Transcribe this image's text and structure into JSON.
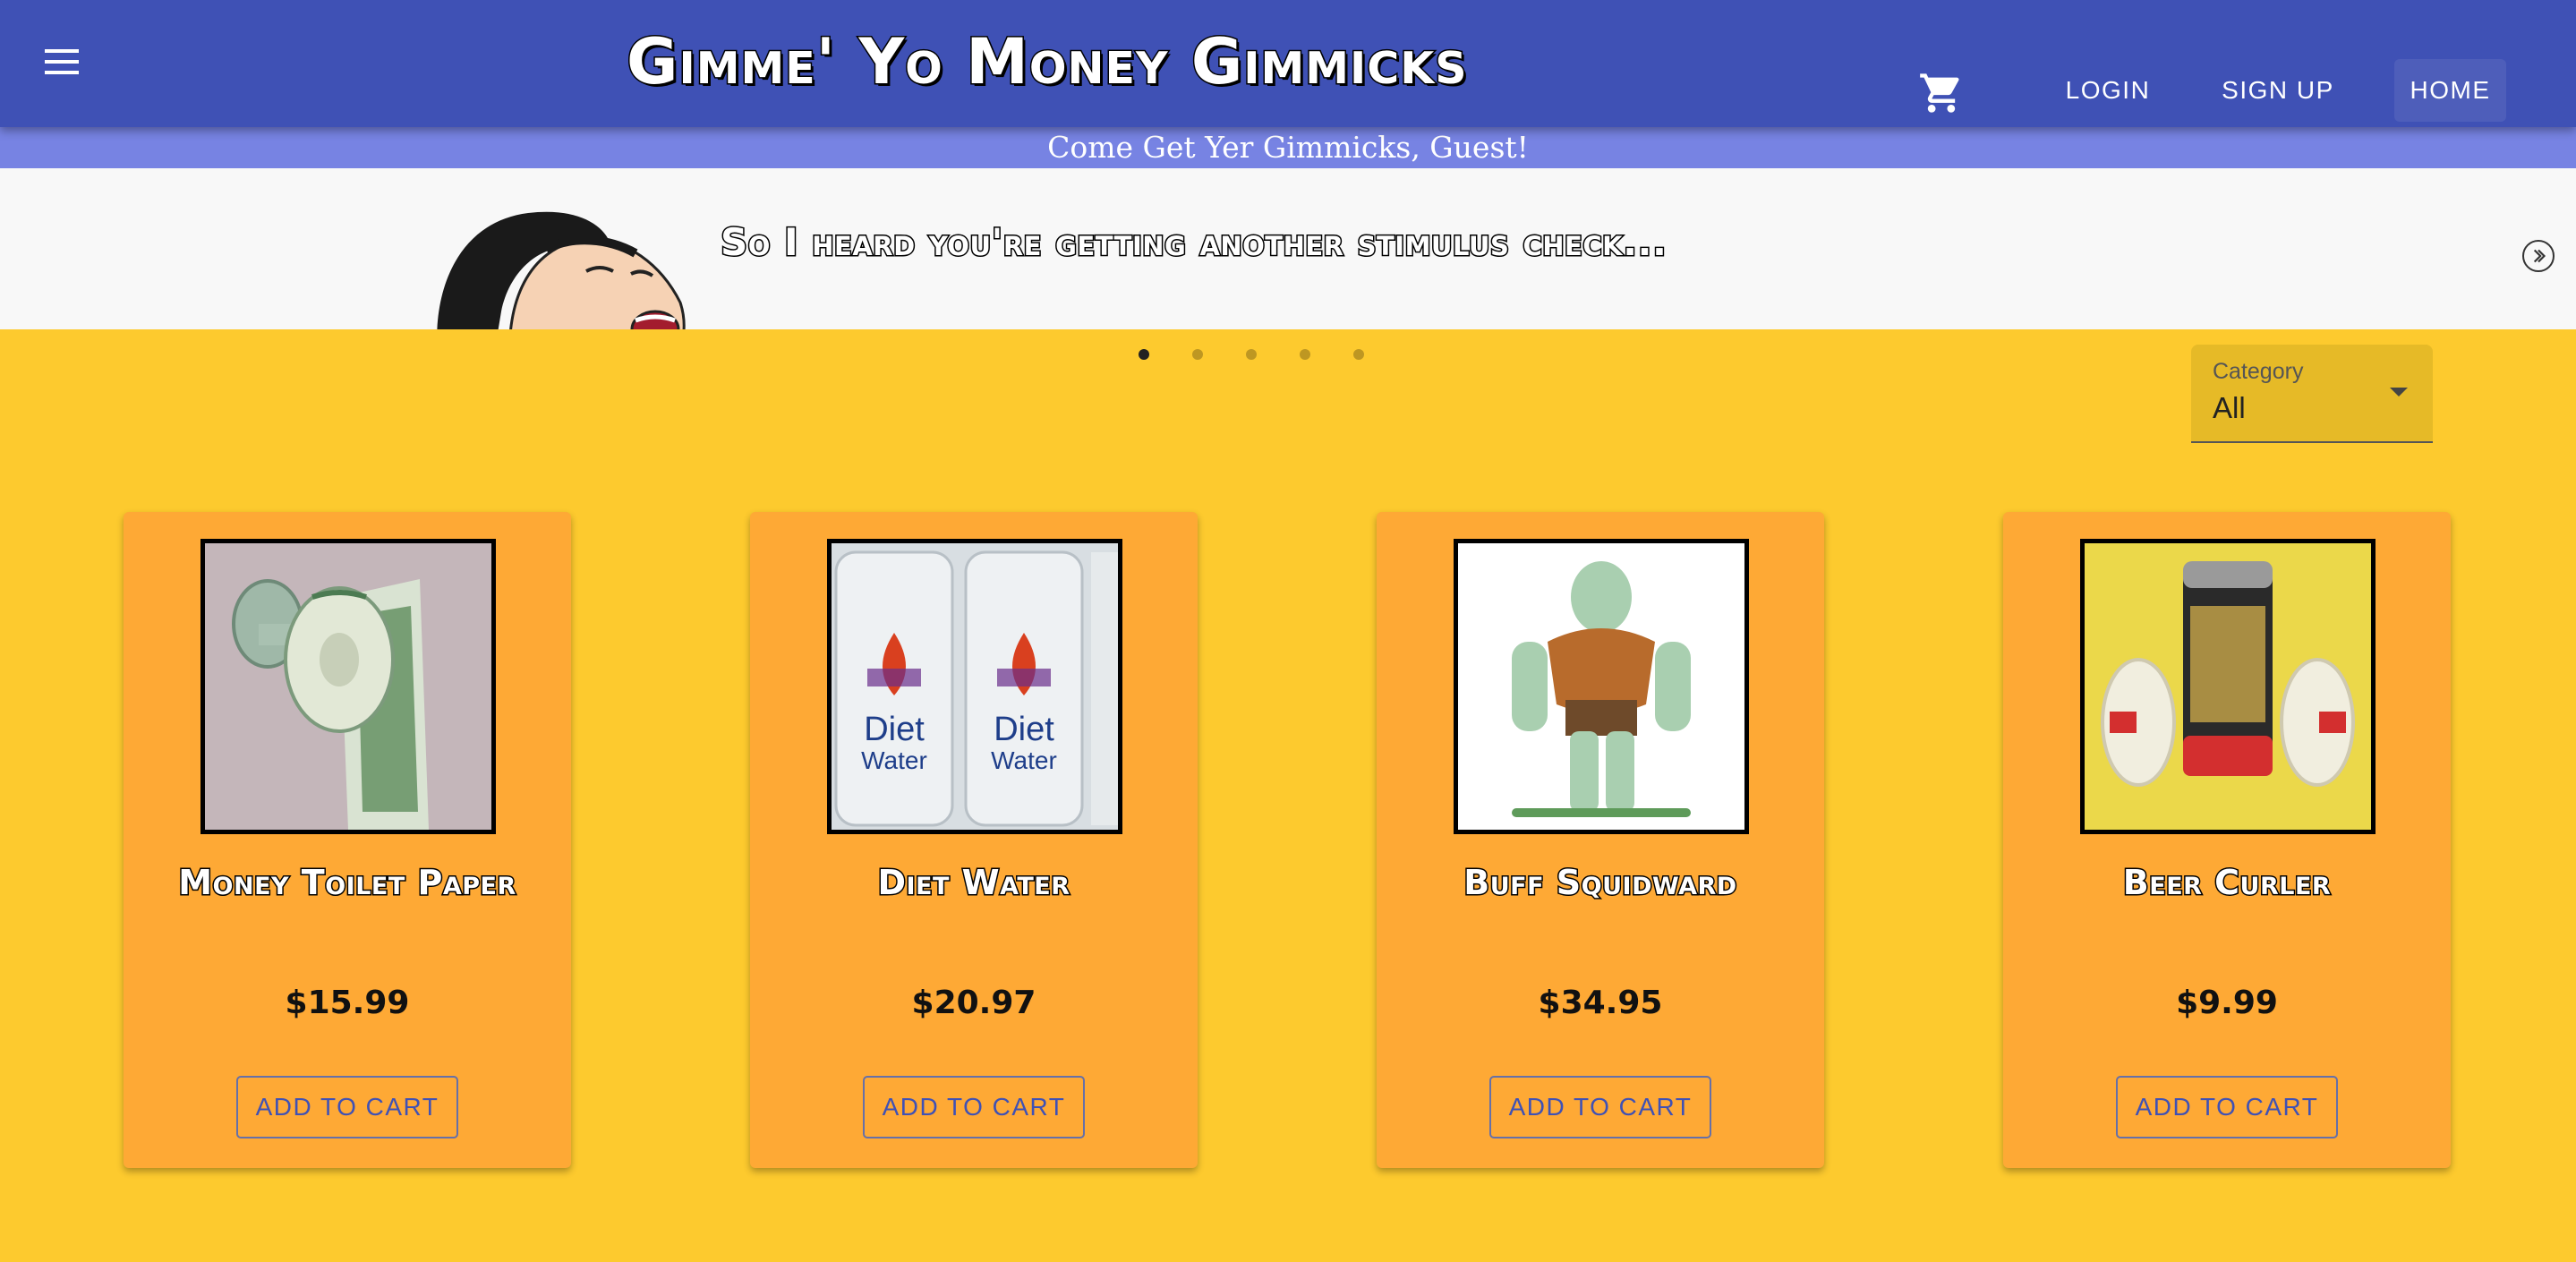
{
  "header": {
    "title": "Gimme' Yo Money Gimmicks",
    "menu_icon": "hamburger-menu-icon",
    "cart_icon": "shopping-cart-icon",
    "nav": {
      "login": "LOGIN",
      "signup": "SIGN UP",
      "home": "HOME"
    },
    "bar_color": "#3F51B5"
  },
  "welcome": {
    "text": "Come Get Yer Gimmicks, Guest!",
    "bar_color": "#7783E3"
  },
  "carousel": {
    "slide_text": "So I heard you're getting another stimulus check...",
    "slide_count": 5,
    "active_index": 0,
    "next_icon": "chevron-right-circle-icon"
  },
  "filter": {
    "label": "Category",
    "value": "All"
  },
  "products": [
    {
      "name": "Money Toilet Paper",
      "price": "$15.99",
      "button": "ADD TO CART",
      "image": "money-toilet-paper-image"
    },
    {
      "name": "Diet Water",
      "price": "$20.97",
      "button": "ADD TO CART",
      "image": "diet-water-bottles-image"
    },
    {
      "name": "Buff Squidward",
      "price": "$34.95",
      "button": "ADD TO CART",
      "image": "buff-squidward-figure-image"
    },
    {
      "name": "Beer Curler",
      "price": "$9.99",
      "button": "ADD TO CART",
      "image": "beer-can-dumbbell-image"
    }
  ],
  "colors": {
    "page_background": "#FDCA2E",
    "card_background": "#FEA935",
    "accent": "#3F51B5"
  }
}
